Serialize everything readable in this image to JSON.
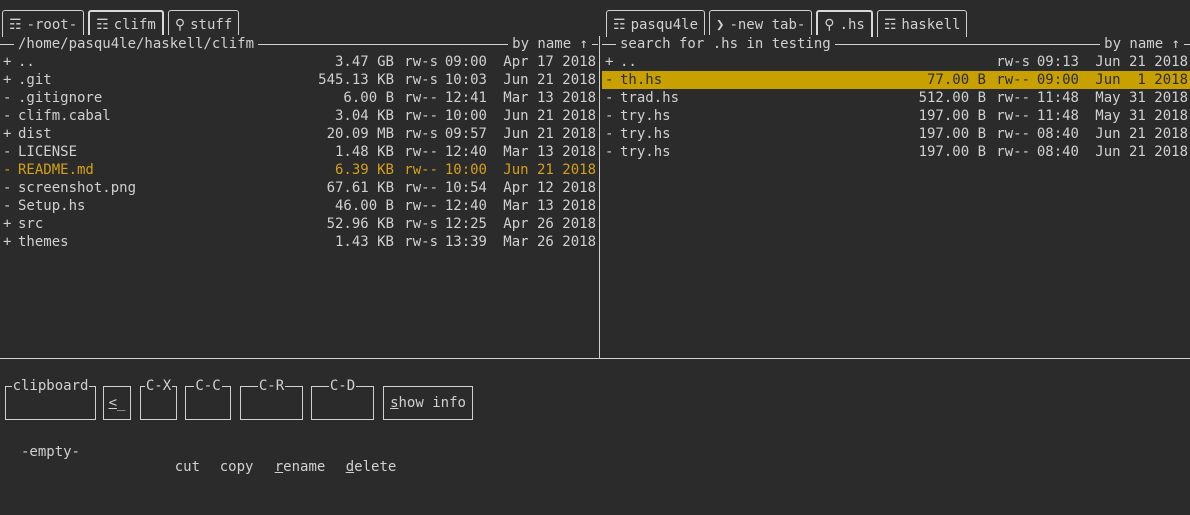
{
  "left_pane": {
    "tabs": [
      {
        "icon": "☶",
        "label": "-root-"
      },
      {
        "icon": "☶",
        "label": "clifm"
      },
      {
        "icon": "⚲",
        "label": "stuff"
      }
    ],
    "path": "/home/pasqu4le/haskell/clifm",
    "sort": "by name ↑",
    "rows": [
      {
        "mark": "+",
        "name": "..",
        "size": "3.47 GB",
        "perm": "rw-s",
        "time": "09:00",
        "date": "Apr 17 2018"
      },
      {
        "mark": "+",
        "name": ".git",
        "size": "545.13 KB",
        "perm": "rw-s",
        "time": "10:03",
        "date": "Jun 21 2018"
      },
      {
        "mark": "-",
        "name": ".gitignore",
        "size": "6.00 B",
        "perm": "rw--",
        "time": "12:41",
        "date": "Mar 13 2018"
      },
      {
        "mark": "-",
        "name": "clifm.cabal",
        "size": "3.04 KB",
        "perm": "rw--",
        "time": "10:00",
        "date": "Jun 21 2018"
      },
      {
        "mark": "+",
        "name": "dist",
        "size": "20.09 MB",
        "perm": "rw-s",
        "time": "09:57",
        "date": "Jun 21 2018"
      },
      {
        "mark": "-",
        "name": "LICENSE",
        "size": "1.48 KB",
        "perm": "rw--",
        "time": "12:40",
        "date": "Mar 13 2018"
      },
      {
        "mark": "-",
        "name": "README.md",
        "size": "6.39 KB",
        "perm": "rw--",
        "time": "10:00",
        "date": "Jun 21 2018"
      },
      {
        "mark": "-",
        "name": "screenshot.png",
        "size": "67.61 KB",
        "perm": "rw--",
        "time": "10:54",
        "date": "Apr 12 2018"
      },
      {
        "mark": "-",
        "name": "Setup.hs",
        "size": "46.00 B",
        "perm": "rw--",
        "time": "12:40",
        "date": "Mar 13 2018"
      },
      {
        "mark": "+",
        "name": "src",
        "size": "52.96 KB",
        "perm": "rw-s",
        "time": "12:25",
        "date": "Apr 26 2018"
      },
      {
        "mark": "+",
        "name": "themes",
        "size": "1.43 KB",
        "perm": "rw-s",
        "time": "13:39",
        "date": "Mar 26 2018"
      }
    ]
  },
  "right_pane": {
    "tabs": [
      {
        "icon": "☶",
        "label": "pasqu4le"
      },
      {
        "icon": "❯",
        "label": "-new tab-"
      },
      {
        "icon": "⚲",
        "label": ".hs"
      },
      {
        "icon": "☶",
        "label": "haskell"
      }
    ],
    "path": "search for .hs in testing",
    "sort": "by name ↑",
    "rows": [
      {
        "mark": "+",
        "name": "..",
        "size": "",
        "perm": "rw-s",
        "time": "09:13",
        "date": "Jun 21 2018"
      },
      {
        "mark": "-",
        "name": "th.hs",
        "size": "77.00 B",
        "perm": "rw--",
        "time": "09:00",
        "date": "Jun  1 2018"
      },
      {
        "mark": "-",
        "name": "trad.hs",
        "size": "512.00 B",
        "perm": "rw--",
        "time": "11:48",
        "date": "May 31 2018"
      },
      {
        "mark": "-",
        "name": "try.hs",
        "size": "197.00 B",
        "perm": "rw--",
        "time": "11:48",
        "date": "May 31 2018"
      },
      {
        "mark": "-",
        "name": "try.hs",
        "size": "197.00 B",
        "perm": "rw--",
        "time": "08:40",
        "date": "Jun 21 2018"
      },
      {
        "mark": "-",
        "name": "try.hs",
        "size": "197.00 B",
        "perm": "rw--",
        "time": "08:40",
        "date": "Jun 21 2018"
      }
    ]
  },
  "toolbar": {
    "clipboard_caption": "clipboard",
    "clipboard_value": "-empty-",
    "back": {
      "key": "<",
      "rest": "_"
    },
    "cut": {
      "caption": "C-X",
      "label": "cut"
    },
    "copy": {
      "caption": "C-C",
      "label": "copy"
    },
    "rename": {
      "caption": "C-R",
      "key": "r",
      "rest": "ename"
    },
    "delete": {
      "caption": "C-D",
      "key": "d",
      "rest": "elete"
    },
    "show_info": {
      "key": "s",
      "rest": "how info"
    }
  },
  "colors": {
    "background": "#2b2b2b",
    "text": "#d0d0d0",
    "marked": "#d4a017",
    "selection": "#c8a000"
  }
}
